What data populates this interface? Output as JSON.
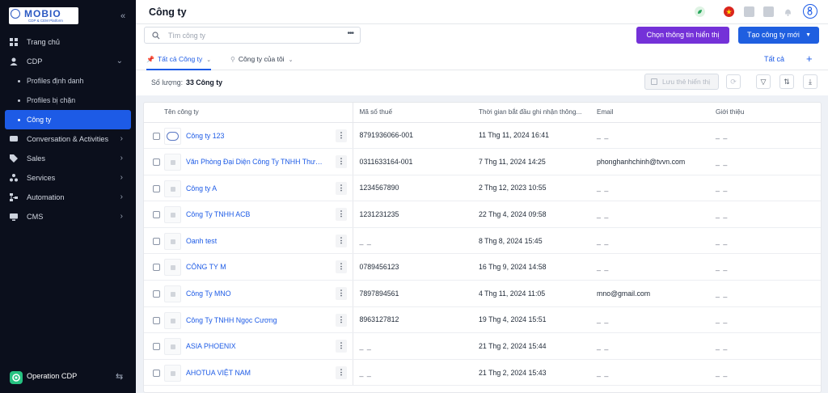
{
  "sidebar": {
    "logo_text": "MOBIO",
    "logo_sub": "CDP & CEM Platform",
    "items": [
      {
        "label": "Trang chủ",
        "icon": "home-icon"
      },
      {
        "label": "CDP",
        "icon": "user-icon",
        "expanded": true
      },
      {
        "label": "Profiles định danh",
        "sub": true
      },
      {
        "label": "Profiles bị chặn",
        "sub": true
      },
      {
        "label": "Công ty",
        "sub": true,
        "active": true
      },
      {
        "label": "Conversation & Activities",
        "icon": "chat-icon"
      },
      {
        "label": "Sales",
        "icon": "tag-icon"
      },
      {
        "label": "Services",
        "icon": "services-icon"
      },
      {
        "label": "Automation",
        "icon": "automation-icon"
      },
      {
        "label": "CMS",
        "icon": "monitor-icon"
      }
    ],
    "bottom_label": "Operation CDP"
  },
  "header": {
    "title": "Công ty"
  },
  "toolbar": {
    "search_placeholder": "Tìm công ty",
    "choose_display_label": "Chọn thông tin hiển thị",
    "create_label": "Tạo công ty mới"
  },
  "tabs": {
    "items": [
      {
        "label": "Tất cả Công ty",
        "active": true
      },
      {
        "label": "Công ty của tôi",
        "active": false
      }
    ],
    "all_link": "Tất cả"
  },
  "count": {
    "label": "Số lượng:",
    "value": "33 Công ty"
  },
  "actions": {
    "save_view_label": "Lưu thẻ hiển thị"
  },
  "table": {
    "columns": [
      "Tên công ty",
      "Mã số thuế",
      "Thời gian bắt đầu ghi nhận thông...",
      "Email",
      "Giới thiệu"
    ],
    "rows": [
      {
        "name": "Công ty 123",
        "tax": "8791936066-001",
        "time": "11 Thg 11, 2024 16:41",
        "email": "_ _",
        "intro": "_ _",
        "logo": true
      },
      {
        "name": "Văn Phòng Đại Diện Công Ty TNHH Thương...",
        "tax": "0311633164-001",
        "time": "7 Thg 11, 2024 14:25",
        "email": "phonghanhchinh@tvvn.com",
        "intro": "_ _"
      },
      {
        "name": "Công ty A",
        "tax": "1234567890",
        "time": "2 Thg 12, 2023 10:55",
        "email": "_ _",
        "intro": "_ _"
      },
      {
        "name": "Công Ty TNHH ACB",
        "tax": "1231231235",
        "time": "22 Thg 4, 2024 09:58",
        "email": "_ _",
        "intro": "_ _"
      },
      {
        "name": "Oanh test",
        "tax": "_ _",
        "time": "8 Thg 8, 2024 15:45",
        "email": "_ _",
        "intro": "_ _"
      },
      {
        "name": "CÔNG TY M",
        "tax": "0789456123",
        "time": "16 Thg 9, 2024 14:58",
        "email": "_ _",
        "intro": "_ _"
      },
      {
        "name": "Công Ty MNO",
        "tax": "7897894561",
        "time": "4 Thg 11, 2024 11:05",
        "email": "mno@gmail.com",
        "intro": "_ _"
      },
      {
        "name": "Công Ty TNHH Ngọc Cương",
        "tax": "8963127812",
        "time": "19 Thg 4, 2024 15:51",
        "email": "_ _",
        "intro": "_ _"
      },
      {
        "name": "ASIA PHOENIX",
        "tax": "_ _",
        "time": "21 Thg 2, 2024 15:44",
        "email": "_ _",
        "intro": "_ _"
      },
      {
        "name": "AHOTUA VIỆT NAM",
        "tax": "_ _",
        "time": "21 Thg 2, 2024 15:43",
        "email": "_ _",
        "intro": "_ _"
      }
    ]
  },
  "colors": {
    "sidebar_bg": "#0b0f1c",
    "active_blue": "#1d5be6",
    "purple": "#7431d8",
    "green": "#26c281"
  }
}
